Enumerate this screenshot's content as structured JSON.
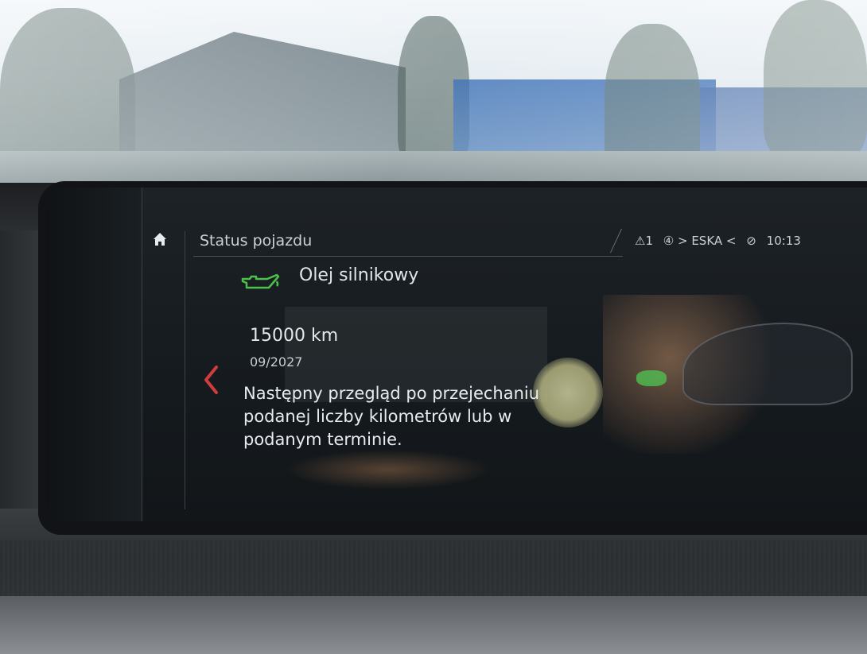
{
  "screen": {
    "title": "Status pojazdu",
    "status": {
      "warning": "⚠1",
      "radio": "④ > ESKA <",
      "mute": "⊘",
      "time": "10:13"
    },
    "item": {
      "name": "Olej silnikowy",
      "icon": "oil-can-icon",
      "icon_color": "#4cc04a",
      "distance": "15000 km",
      "date": "09/2027",
      "description": "Następny przegląd po przejechaniu podanej liczby kilometrów lub w podanym terminie."
    },
    "back_arrow_color": "#d23c3c"
  }
}
